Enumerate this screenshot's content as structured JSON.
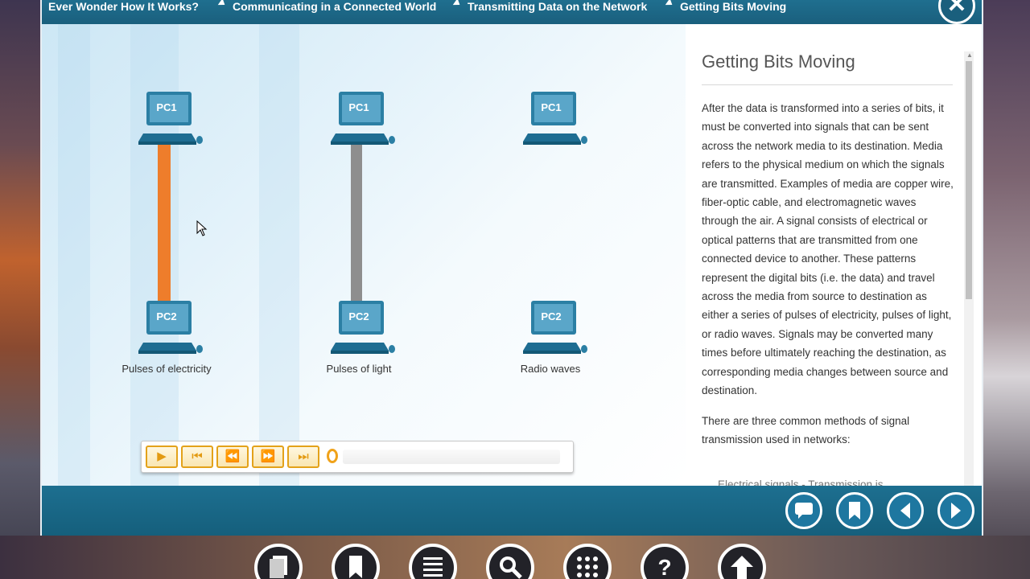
{
  "breadcrumbs": [
    {
      "label": "Ever Wonder How It Works?"
    },
    {
      "label": "Communicating in a Connected World"
    },
    {
      "label": "Transmitting Data on the Network"
    },
    {
      "label": "Getting Bits Moving"
    }
  ],
  "close_label": "✕",
  "diagram": {
    "columns": [
      {
        "top_pc": "PC1",
        "bottom_pc": "PC2",
        "caption": "Pulses of electricity",
        "media": "copper-cable",
        "cable_color": "#ee7d2b"
      },
      {
        "top_pc": "PC1",
        "bottom_pc": "PC2",
        "caption": "Pulses of light",
        "media": "fiber-cable",
        "cable_color": "#8e8e8e"
      },
      {
        "top_pc": "PC1",
        "bottom_pc": "PC2",
        "caption": "Radio waves",
        "media": "wireless",
        "cable_color": ""
      }
    ]
  },
  "player": {
    "progress_percent": 0
  },
  "panel": {
    "title": "Getting Bits Moving",
    "paragraphs": [
      "After the data is transformed into a series of bits, it must be converted into signals that can be sent across the network media to its destination. Media refers to the physical medium on which the signals are transmitted. Examples of media are copper wire, fiber-optic cable, and electromagnetic waves through the air. A signal consists of electrical or optical patterns that are transmitted from one connected device to another. These patterns represent the digital bits (i.e. the data) and travel across the media from source to destination as either a series of pulses of electricity, pulses of light, or radio waves. Signals may be converted many times before ultimately reaching the destination, as corresponding media changes between source and destination.",
      "There are three common methods of signal transmission used in networks:"
    ],
    "cut_off_line": "Electrical signals - Transmission is"
  },
  "nav_buttons": [
    "comment-icon",
    "bookmark-icon",
    "previous-icon",
    "next-icon"
  ],
  "dock": [
    "pages-icon",
    "bookmark-icon",
    "menu-icon",
    "search-icon",
    "apps-icon",
    "help-icon",
    "up-arrow-icon"
  ],
  "colors": {
    "topbar": "#1a5f7d",
    "accent": "#1e77a0",
    "player_accent": "#e3a21a",
    "copper": "#ee7d2b",
    "fiber": "#8e8e8e"
  }
}
